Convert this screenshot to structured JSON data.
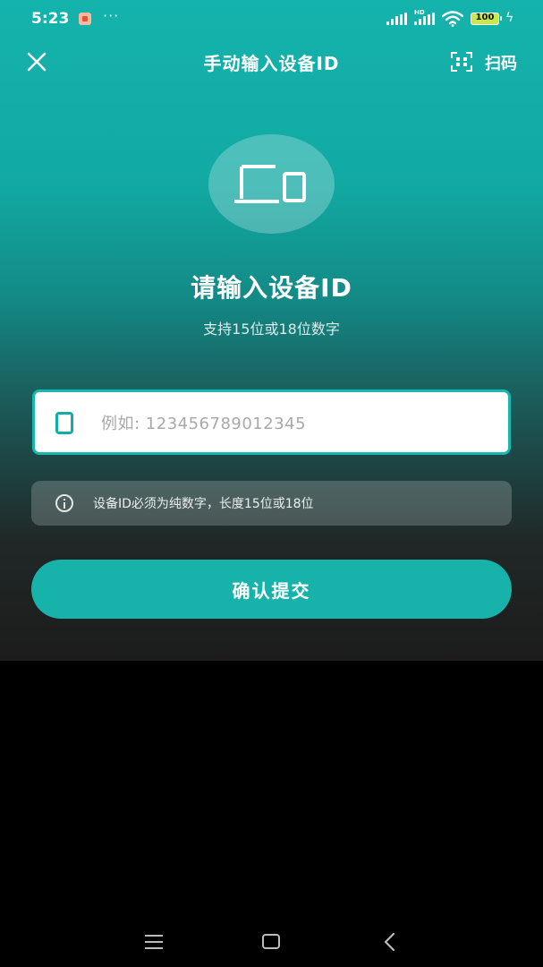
{
  "status_bar": {
    "time": "5:23",
    "more": "···",
    "hd_label": "HD",
    "battery": "100",
    "charging_icon": "bolt-icon"
  },
  "header": {
    "close_icon": "close-icon",
    "title": "手动输入设备ID",
    "scan_icon": "qr-scan-icon",
    "scan_label": "扫码"
  },
  "hero": {
    "icon": "device-icon",
    "title": "请输入设备ID",
    "subtitle": "支持15位或18位数字"
  },
  "input": {
    "icon": "phone-icon",
    "value": "",
    "placeholder": "例如: 123456789012345"
  },
  "hint": {
    "icon": "info-icon",
    "text": "设备ID必须为纯数字，长度15位或18位"
  },
  "submit": {
    "label": "确认提交"
  },
  "colors": {
    "accent": "#17b3aa",
    "background": "#000000"
  },
  "nav_bar": {
    "menu_icon": "menu-icon",
    "home_icon": "home-icon",
    "back_icon": "back-icon"
  }
}
